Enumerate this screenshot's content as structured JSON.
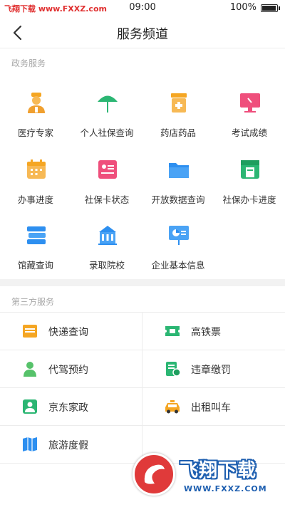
{
  "status_bar": {
    "watermark": "飞翔下载 www.FXXZ.com",
    "time": "09:00",
    "battery_percent_text": "100%",
    "battery_level": 1.0
  },
  "nav": {
    "back_icon": "chevron-left-icon",
    "title": "服务频道"
  },
  "gov_section": {
    "label": "政务服务",
    "items": [
      {
        "label": "医疗专家",
        "icon": "doctor-icon",
        "color": "#f0a030"
      },
      {
        "label": "个人社保查询",
        "icon": "umbrella-icon",
        "color": "#2bb673"
      },
      {
        "label": "药店药品",
        "icon": "medicine-box-icon",
        "color": "#f5a623"
      },
      {
        "label": "考试成绩",
        "icon": "monitor-icon",
        "color": "#ef4f7c"
      },
      {
        "label": "办事进度",
        "icon": "calendar-icon",
        "color": "#f5a623"
      },
      {
        "label": "社保卡状态",
        "icon": "id-card-icon",
        "color": "#ef4f7c"
      },
      {
        "label": "开放数据查询",
        "icon": "folder-icon",
        "color": "#2d8ff0"
      },
      {
        "label": "社保办卡进度",
        "icon": "card-reader-icon",
        "color": "#2bb673"
      },
      {
        "label": "馆藏查询",
        "icon": "books-icon",
        "color": "#2d8ff0"
      },
      {
        "label": "录取院校",
        "icon": "school-building-icon",
        "color": "#2d8ff0"
      },
      {
        "label": "企业基本信息",
        "icon": "presentation-icon",
        "color": "#2d8ff0"
      }
    ]
  },
  "third_party_section": {
    "label": "第三方服务",
    "items": [
      {
        "label": "快递查询",
        "icon": "package-icon",
        "color": "#f5a623"
      },
      {
        "label": "高铁票",
        "icon": "ticket-icon",
        "color": "#2bb673"
      },
      {
        "label": "代驾预约",
        "icon": "driver-person-icon",
        "color": "#56c26a"
      },
      {
        "label": "违章缴罚",
        "icon": "fine-document-icon",
        "color": "#2bb673"
      },
      {
        "label": "京东家政",
        "icon": "housekeeping-icon",
        "color": "#2bb673"
      },
      {
        "label": "出租叫车",
        "icon": "taxi-icon",
        "color": "#f5a623"
      },
      {
        "label": "旅游度假",
        "icon": "map-icon",
        "color": "#2d8ff0"
      }
    ]
  },
  "badge": {
    "brand": "飞翔下载",
    "url": "WWW.FXXZ.COM"
  }
}
